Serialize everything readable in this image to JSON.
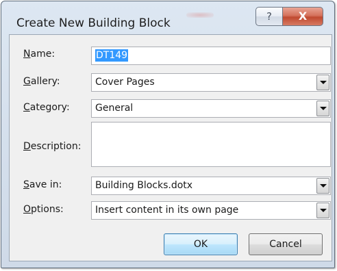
{
  "window": {
    "title": "Create New Building Block",
    "help_glyph": "?",
    "close_glyph": "X"
  },
  "form": {
    "name": {
      "label_mnemonic": "N",
      "label_rest": "ame:",
      "value": "DT149"
    },
    "gallery": {
      "label_mnemonic": "G",
      "label_rest": "allery:",
      "value": "Cover Pages"
    },
    "category": {
      "label_mnemonic": "C",
      "label_rest": "ategory:",
      "value": "General"
    },
    "description": {
      "label_mnemonic": "D",
      "label_rest": "escription:",
      "value": ""
    },
    "save_in": {
      "label_mnemonic": "S",
      "label_rest": "ave in:",
      "value": "Building Blocks.dotx"
    },
    "options": {
      "label_mnemonic": "O",
      "label_rest": "ptions:",
      "value": "Insert content in its own page"
    }
  },
  "buttons": {
    "ok_label": "OK",
    "cancel_label": "Cancel"
  },
  "icons": {
    "help": "help-icon",
    "close": "close-icon",
    "dropdown": "chevron-down-icon"
  }
}
